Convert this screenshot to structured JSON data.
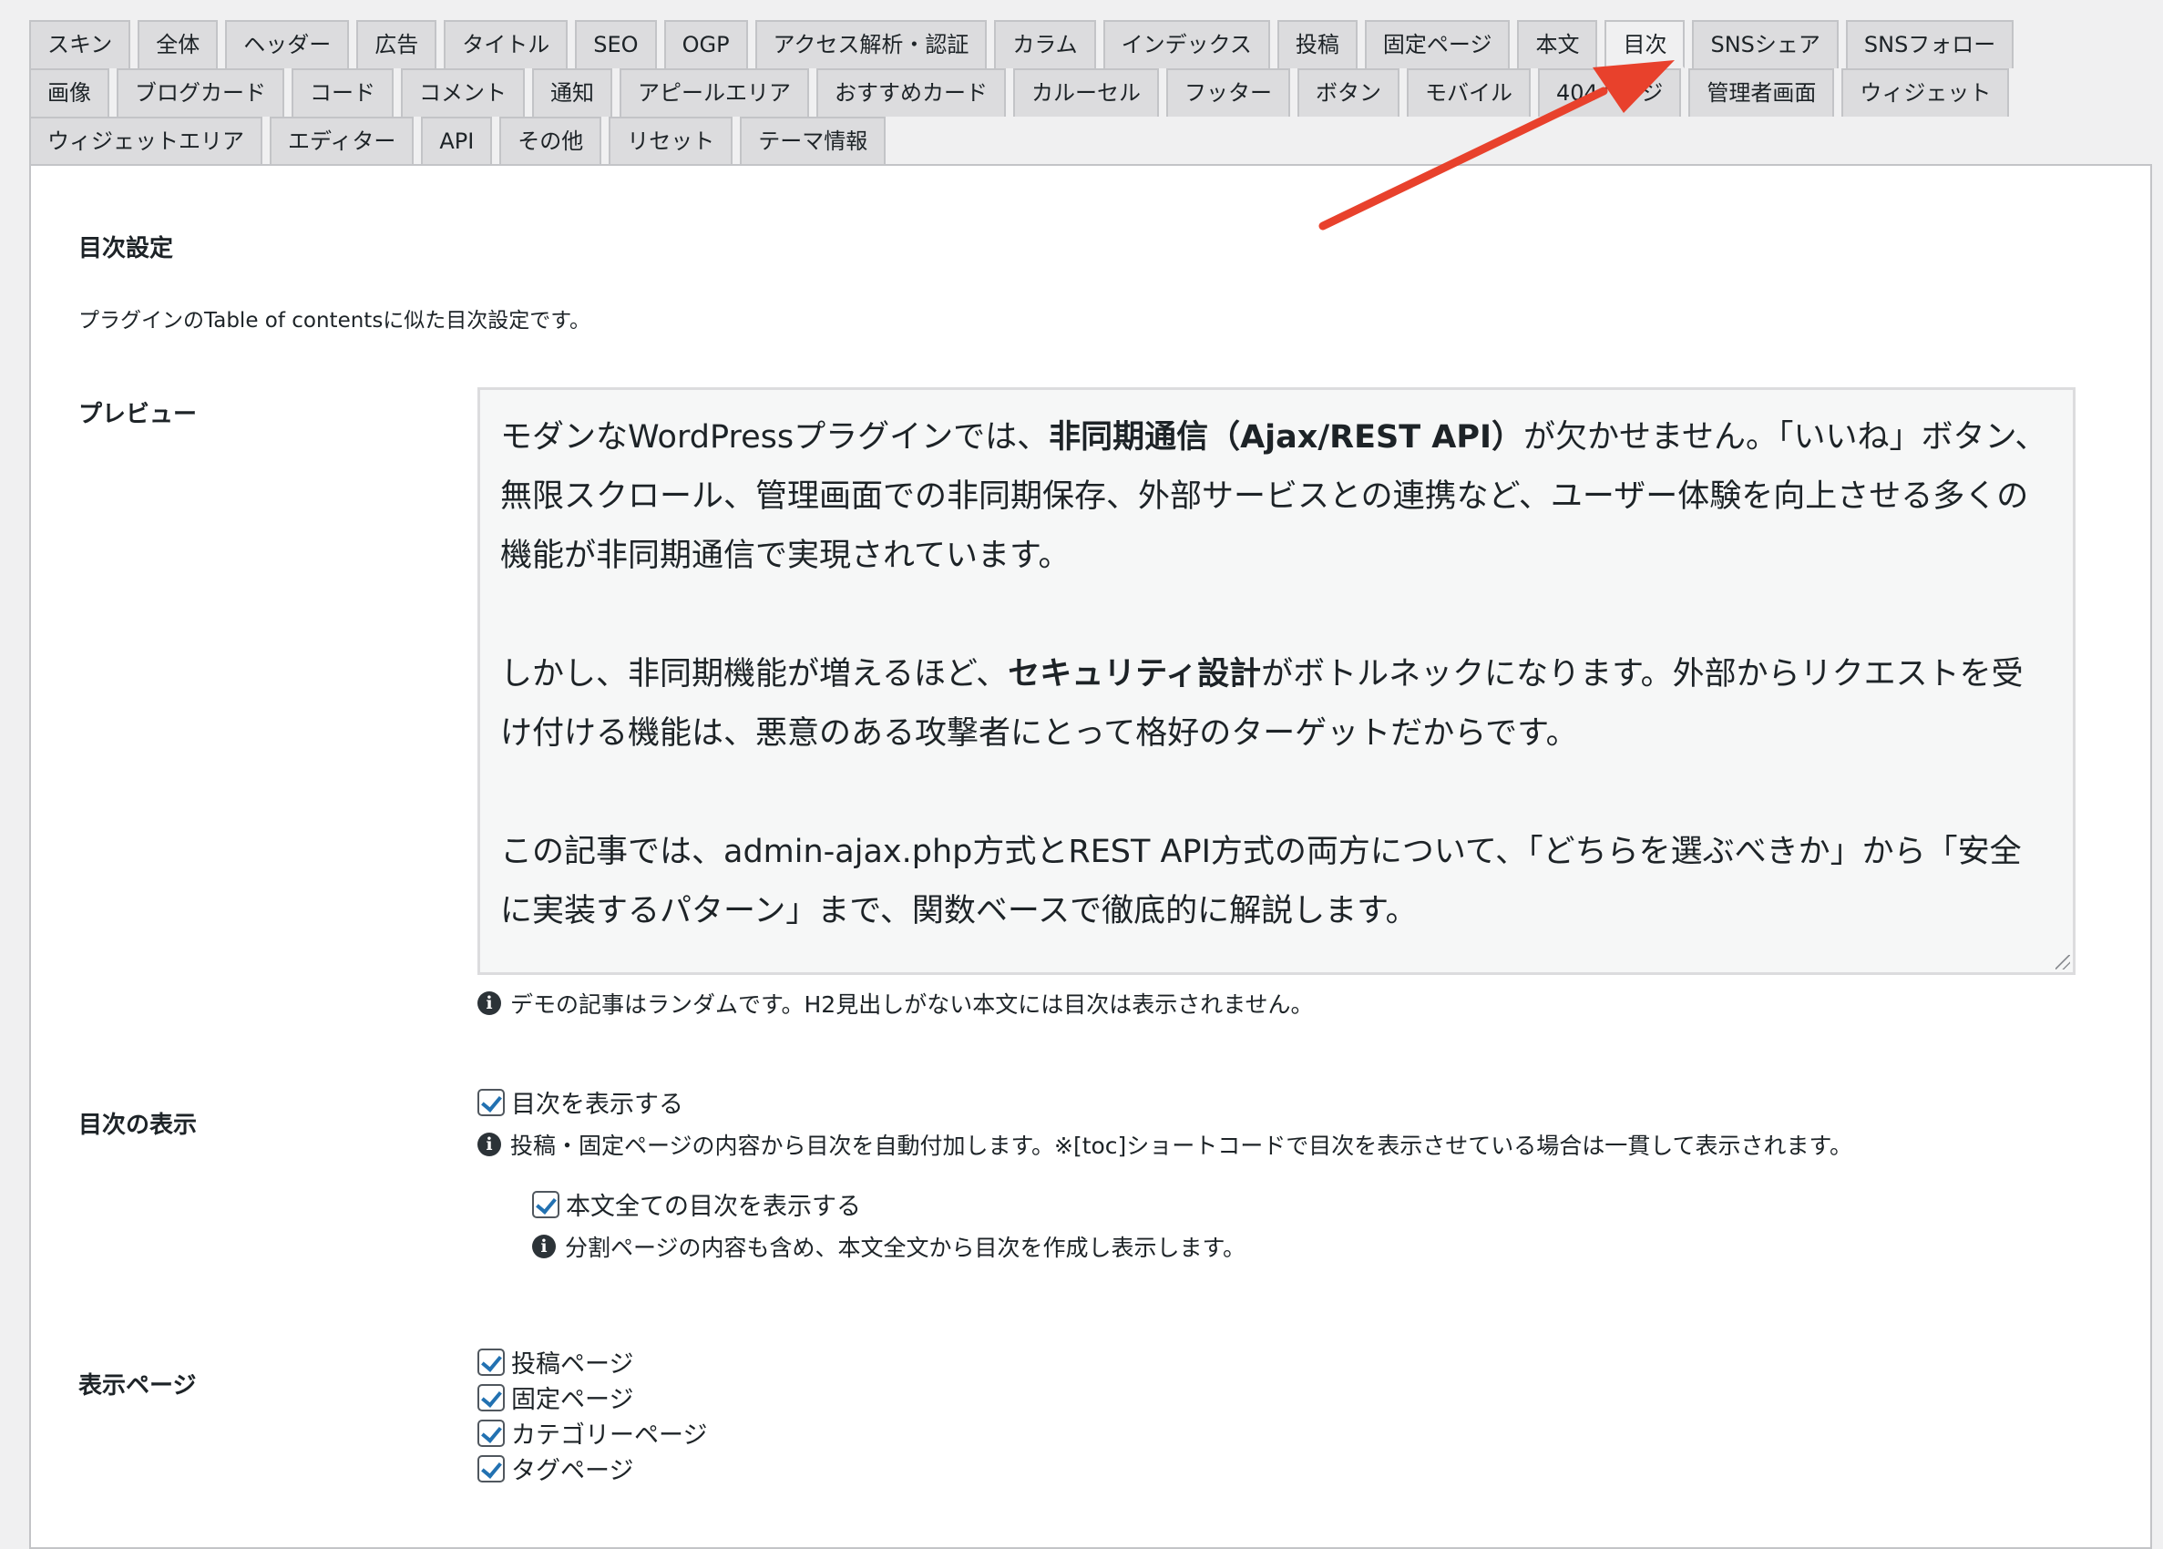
{
  "tabs": {
    "row1": [
      "スキン",
      "全体",
      "ヘッダー",
      "広告",
      "タイトル",
      "SEO",
      "OGP",
      "アクセス解析・認証",
      "カラム",
      "インデックス",
      "投稿",
      "固定ページ",
      "本文",
      "目次",
      "SNSシェア",
      "SNSフォロー"
    ],
    "row2": [
      "画像",
      "ブログカード",
      "コード",
      "コメント",
      "通知",
      "アピールエリア",
      "おすすめカード",
      "カルーセル",
      "フッター",
      "ボタン",
      "モバイル",
      "404ページ",
      "管理者画面",
      "ウィジェット"
    ],
    "row3": [
      "ウィジェットエリア",
      "エディター",
      "API",
      "その他",
      "リセット",
      "テーマ情報"
    ],
    "active": "目次"
  },
  "section": {
    "title": "目次設定",
    "description": "プラグインのTable of contentsに似た目次設定です。"
  },
  "preview": {
    "label": "プレビュー",
    "p1_before": "モダンなWordPressプラグインでは、",
    "p1_bold": "非同期通信（Ajax/REST API）",
    "p1_after": "が欠かせません。「いいね」ボタン、無限スクロール、管理画面での非同期保存、外部サービスとの連携など、ユーザー体験を向上させる多くの機能が非同期通信で実現されています。",
    "p2_before": "しかし、非同期機能が増えるほど、",
    "p2_bold": "セキュリティ設計",
    "p2_after": "がボトルネックになります。外部からリクエストを受け付ける機能は、悪意のある攻撃者にとって格好のターゲットだからです。",
    "p3": "この記事では、admin-ajax.php方式とREST API方式の両方について、「どちらを選ぶべきか」から「安全に実装するパターン」まで、関数ベースで徹底的に解説します。",
    "note": "デモの記事はランダムです。H2見出しがない本文には目次は表示されません。"
  },
  "toc_display": {
    "label": "目次の表示",
    "show_toc": "目次を表示する",
    "show_toc_note": "投稿・固定ページの内容から目次を自動付加します。※[toc]ショートコードで目次を表示させている場合は一貫して表示されます。",
    "show_all": "本文全ての目次を表示する",
    "show_all_note": "分割ページの内容も含め、本文全文から目次を作成し表示します。"
  },
  "display_pages": {
    "label": "表示ページ",
    "items": [
      "投稿ページ",
      "固定ページ",
      "カテゴリーページ",
      "タグページ"
    ]
  },
  "icons": {
    "info": "i"
  },
  "colors": {
    "accent": "#2271b1",
    "arrow": "#e8412c"
  }
}
